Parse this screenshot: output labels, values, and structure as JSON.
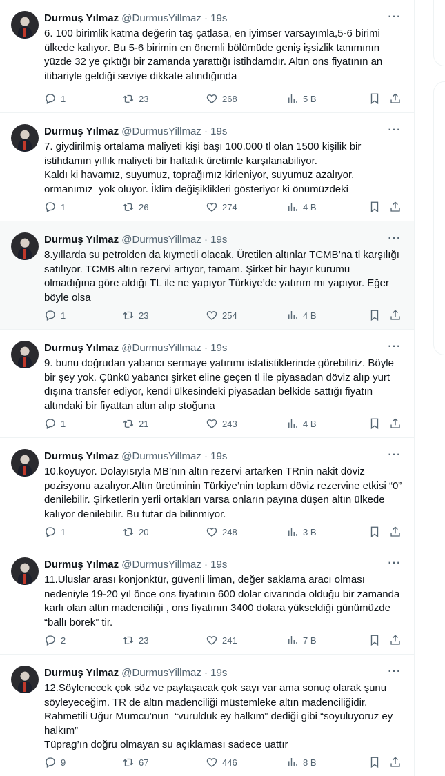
{
  "author": {
    "name": "Durmuş Yılmaz",
    "handle": "@DurmusYillmaz",
    "dot": "·",
    "time": "19s"
  },
  "more_label": "···",
  "tweets": [
    {
      "text": "6. 100 birimlik katma değerin taş çatlasa, en iyimser varsayımla,5-6 birimi ülkede kalıyor. Bu 5-6 birimin en önemli bölümüde geniş işsizlik tanımının yüzde 32 ye çıktığı bir zamanda yarattığı istihdamdır. Altın ons fiyatının an itibariyle geldiği seviye dikkate alındığında",
      "replies": "1",
      "reposts": "23",
      "likes": "268",
      "views": "5 B"
    },
    {
      "text": "7. giydirilmiş ortalama maliyeti kişi başı 100.000 tl olan 1500 kişilik bir istihdamın yıllık maliyeti bir haftalık üretimle karşılanabiliyor.\nKaldı ki havamız, suyumuz, toprağımız kirleniyor, suyumuz azalıyor, ormanımız  yok oluyor. İklim değişiklikleri gösteriyor ki önümüzdeki",
      "replies": "1",
      "reposts": "26",
      "likes": "274",
      "views": "4 B"
    },
    {
      "text": "8.yıllarda su petrolden da kıymetli olacak. Üretilen altınlar TCMB’na tl karşılığı satılıyor. TCMB altın rezervi artıyor, tamam. Şirket bir hayır kurumu olmadığına göre aldığı TL ile ne yapıyor Türkiye’de yatırım mı yapıyor. Eğer böyle olsa",
      "replies": "1",
      "reposts": "23",
      "likes": "254",
      "views": "4 B"
    },
    {
      "text": "9. bunu doğrudan yabancı sermaye yatırımı istatistiklerinde görebiliriz. Böyle bir şey yok. Çünkü yabancı şirket eline geçen tl ile piyasadan döviz alıp yurt dışına transfer ediyor, kendi ülkesindeki piyasadan belkide sattığı fiyatın altındaki bir fiyattan altın alıp stoğuna",
      "replies": "1",
      "reposts": "21",
      "likes": "243",
      "views": "4 B"
    },
    {
      "text": "10.koyuyor. Dolayısıyla MB’nın altın rezervi artarken TRnin nakit döviz pozisyonu azalıyor.Altın üretiminin Türkiye’nin toplam döviz rezervine etkisi “0” denilebilir. Şirketlerin yerli ortakları varsa onların payına düşen altın ülkede kalıyor denilebilir. Bu tutar da bilinmiyor.",
      "replies": "1",
      "reposts": "20",
      "likes": "248",
      "views": "3 B"
    },
    {
      "text": "11.Uluslar arası konjonktür, güvenli liman, değer saklama aracı olması nedeniyle 19-20 yıl önce ons fiyatının 600 dolar civarında olduğu bir zamanda karlı olan altın madenciliği , ons fiyatının 3400 dolara yükseldiği günümüzde “ballı börek” tir.",
      "replies": "2",
      "reposts": "23",
      "likes": "241",
      "views": "7 B"
    },
    {
      "text": "12.Söylenecek çok söz ve paylaşacak çok sayı var ama sonuç olarak şunu söyleyeceğim. TR de altın madenciliği müstemleke altın madenciliğidir.\nRahmetili Uğur Mumcu’nun  “vurulduk ey halkım” dediği gibi “soyuluyoruz ey halkım”\nTüprag’ın doğru olmayan su açıklaması sadece uattır",
      "replies": "9",
      "reposts": "67",
      "likes": "446",
      "views": "8 B"
    }
  ]
}
